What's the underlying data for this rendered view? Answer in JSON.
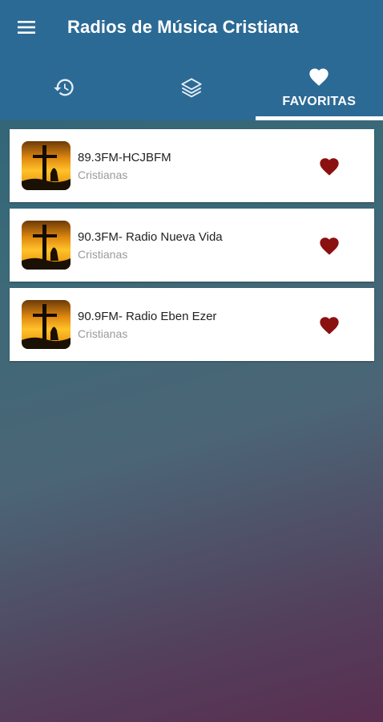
{
  "app": {
    "title": "Radios de Música Cristiana",
    "menu_icon": "hamburger-menu-icon"
  },
  "tabs": [
    {
      "icon": "history-icon",
      "label": "",
      "active": false
    },
    {
      "icon": "layers-icon",
      "label": "",
      "active": false
    },
    {
      "icon": "heart-icon",
      "label": "FAVORITAS",
      "active": true
    }
  ],
  "stations": [
    {
      "name": "89.3FM-HCJBFM",
      "genre": "Cristianas",
      "favorite": true
    },
    {
      "name": "90.3FM- Radio Nueva Vida",
      "genre": "Cristianas",
      "favorite": true
    },
    {
      "name": "90.9FM- Radio Eben Ezer",
      "genre": "Cristianas",
      "favorite": true
    }
  ],
  "colors": {
    "primary": "#2c6a96",
    "favorite_heart": "#8b1010",
    "card_bg": "#ffffff"
  }
}
